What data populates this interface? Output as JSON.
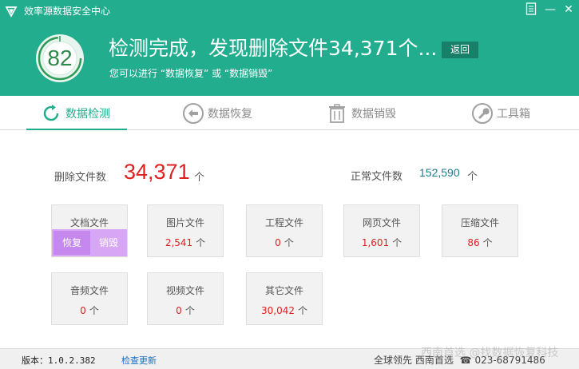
{
  "window": {
    "title": "效率源数据安全中心",
    "controls": {
      "menu": "menu-icon",
      "minimize": "—",
      "close": "✕"
    }
  },
  "header": {
    "score": "82",
    "headline": "检测完成，发现删除文件34,371个...",
    "subline": "您可以进行 “数据恢复” 或 “数据销毁”",
    "back_label": "返回"
  },
  "tabs": [
    {
      "label": "数据检测",
      "icon": "refresh-icon",
      "active": true
    },
    {
      "label": "数据恢复",
      "icon": "back-arrow-icon",
      "active": false
    },
    {
      "label": "数据销毁",
      "icon": "trash-icon",
      "active": false
    },
    {
      "label": "工具箱",
      "icon": "wrench-icon",
      "active": false
    }
  ],
  "summary": {
    "deleted_label": "删除文件数",
    "deleted_value": "34,371",
    "deleted_unit": "个",
    "normal_label": "正常文件数",
    "normal_value": "152,590",
    "normal_unit": "个"
  },
  "cards": [
    {
      "name": "文档文件",
      "count": "",
      "unit": "",
      "recover_label": "恢复",
      "destroy_label": "销毁"
    },
    {
      "name": "图片文件",
      "count": "2,541",
      "unit": "个"
    },
    {
      "name": "工程文件",
      "count": "0",
      "unit": "个"
    },
    {
      "name": "网页文件",
      "count": "1,601",
      "unit": "个"
    },
    {
      "name": "压缩文件",
      "count": "86",
      "unit": "个"
    },
    {
      "name": "音频文件",
      "count": "0",
      "unit": "个"
    },
    {
      "name": "视频文件",
      "count": "0",
      "unit": "个"
    },
    {
      "name": "其它文件",
      "count": "30,042",
      "unit": "个"
    }
  ],
  "statusbar": {
    "version": "版本：1.0.2.382",
    "update_label": "检查更新",
    "company": "全球领先 西南首选",
    "phone": "023-68791486"
  },
  "watermark": "西南首选 @找数据恢复科技",
  "colors": {
    "brand": "#21ad8e",
    "accent_red": "#e02020",
    "hover_purple": "#d7a6f5"
  }
}
